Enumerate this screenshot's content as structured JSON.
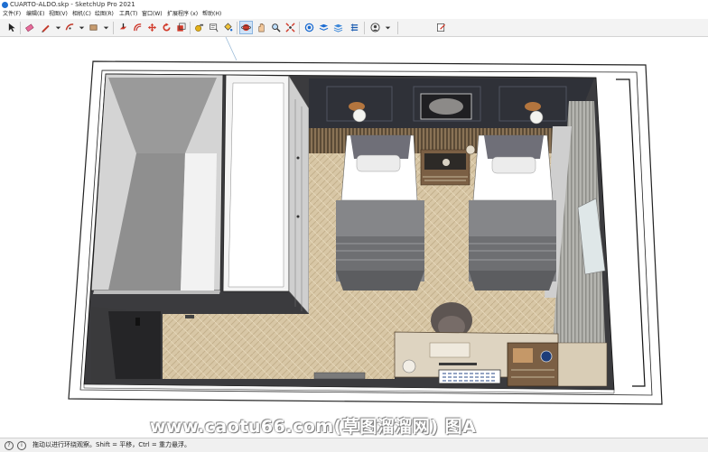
{
  "window": {
    "title": "CUARTO-ALDO.skp - SketchUp Pro 2021"
  },
  "menu": [
    {
      "label": "文件(F)"
    },
    {
      "label": "编辑(E)"
    },
    {
      "label": "视图(V)"
    },
    {
      "label": "相机(C)"
    },
    {
      "label": "绘图(R)"
    },
    {
      "label": "工具(T)"
    },
    {
      "label": "窗口(W)"
    },
    {
      "label": "扩展程序 (x)"
    },
    {
      "label": "帮助(H)"
    }
  ],
  "toolbar": {
    "tools": [
      {
        "icon": "select-arrow-icon"
      },
      {
        "icon": "eraser-icon"
      },
      {
        "icon": "line-pencil-icon"
      },
      {
        "icon": "arc-icon"
      },
      {
        "icon": "rectangle-icon"
      },
      {
        "icon": "push-pull-icon"
      },
      {
        "icon": "offset-icon"
      },
      {
        "icon": "move-icon"
      },
      {
        "icon": "rotate-icon"
      },
      {
        "icon": "scale-icon"
      },
      {
        "icon": "tape-measure-icon"
      },
      {
        "icon": "text-icon"
      },
      {
        "icon": "paint-bucket-icon"
      },
      {
        "icon": "orbit-icon"
      },
      {
        "icon": "pan-hand-icon"
      },
      {
        "icon": "zoom-icon"
      },
      {
        "icon": "zoom-extents-icon"
      },
      {
        "icon": "warehouse-icon"
      },
      {
        "icon": "extension-warehouse-icon"
      },
      {
        "icon": "layout-icon"
      },
      {
        "icon": "user-account-icon"
      },
      {
        "icon": "edit-note-icon"
      }
    ]
  },
  "status": {
    "text": "拖动以进行环绕观察。Shift = 平移，Ctrl = 重力悬浮。"
  },
  "watermark": {
    "text": "www.caotu66.com(草图溜溜网) 图A"
  }
}
